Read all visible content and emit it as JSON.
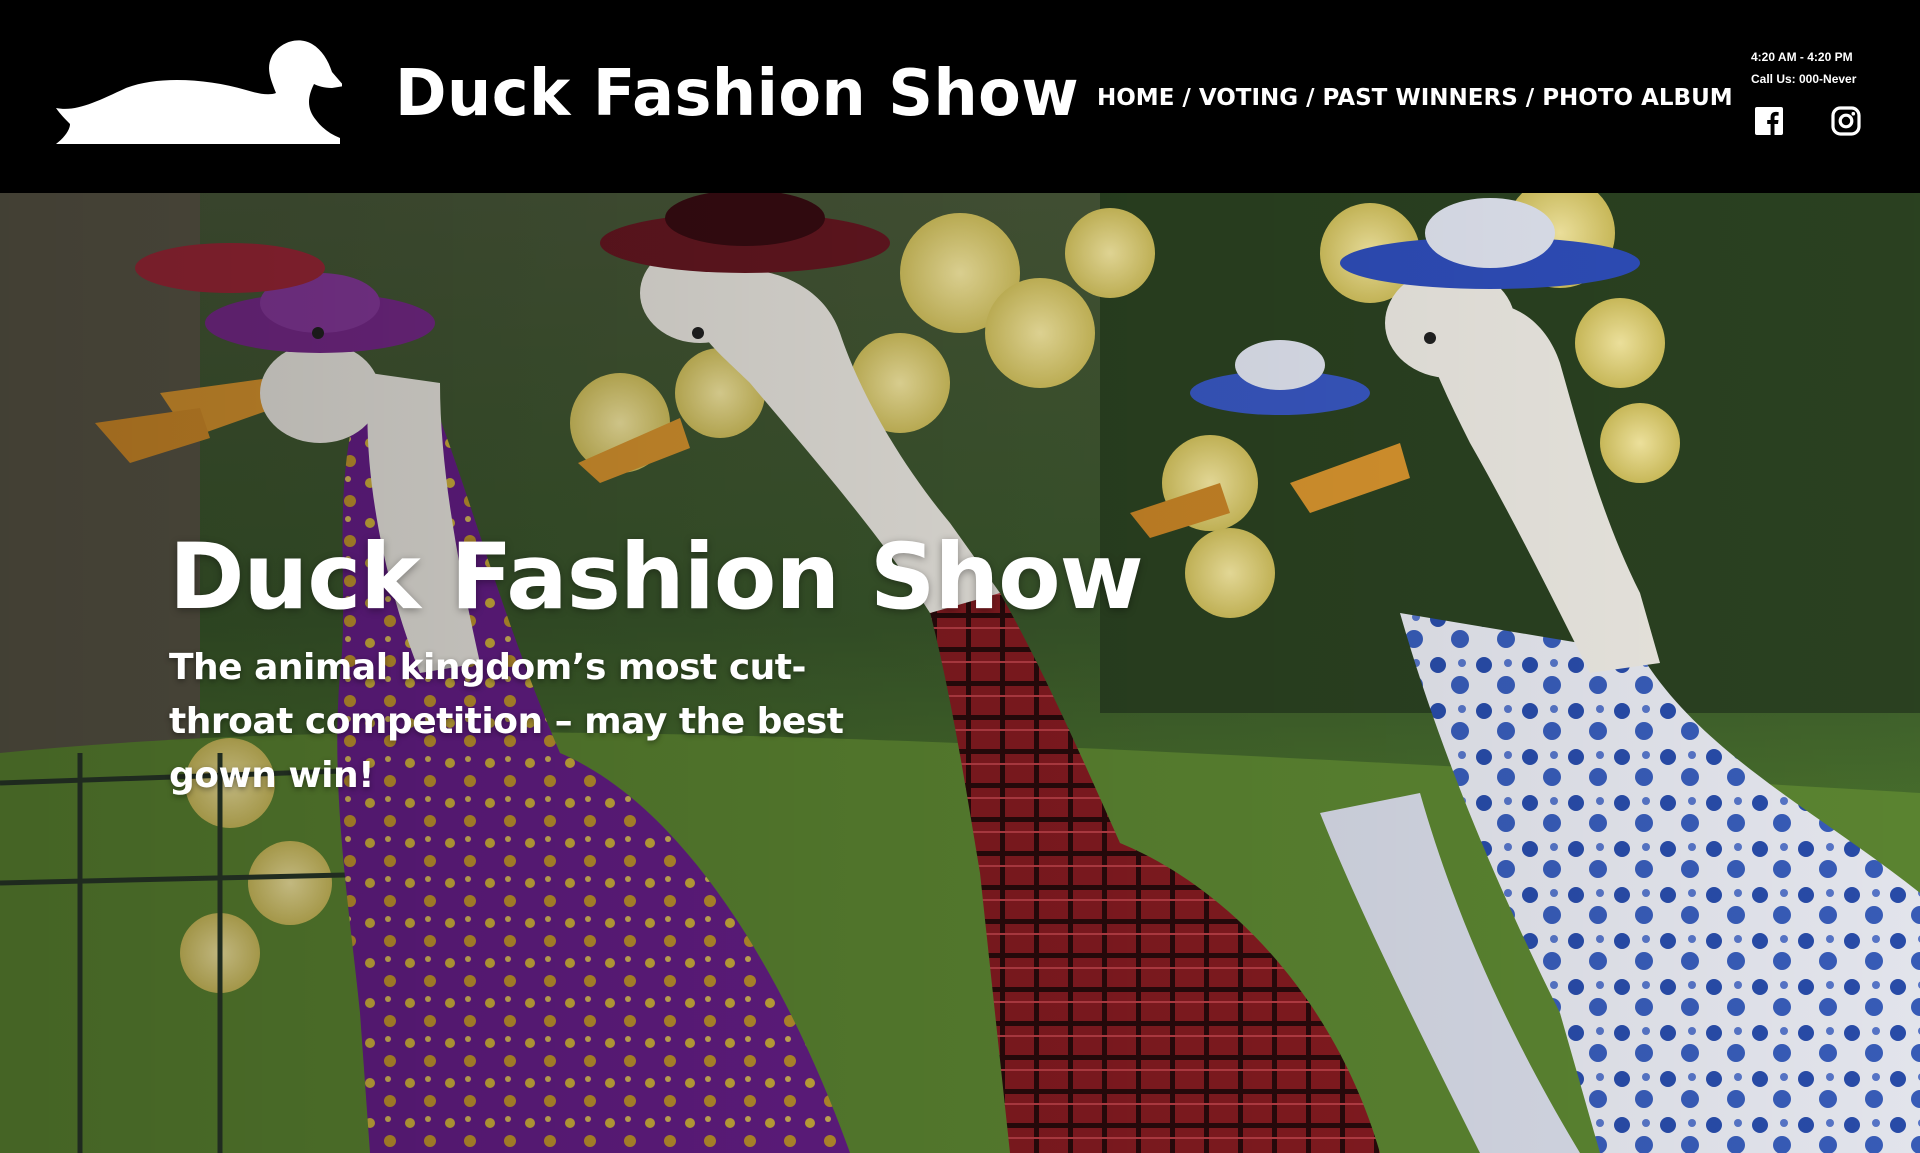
{
  "header": {
    "brand_title": "Duck Fashion Show",
    "logo_icon": "duck-silhouette-icon",
    "nav": {
      "home": "HOME",
      "voting": "VOTING",
      "past_winners": "PAST WINNERS",
      "photo_album": "PHOTO ALBUM",
      "separator": "/"
    },
    "hours": "4:20 AM - 4:20 PM",
    "phone": "Call Us: 000-Never",
    "social": {
      "facebook_icon": "facebook-icon",
      "instagram_icon": "instagram-icon"
    }
  },
  "hero": {
    "title": "Duck Fashion Show",
    "subtitle": "The animal kingdom’s most cut-throat competition – may the best gown win!",
    "background": "ducks-in-dresses-photo"
  },
  "colors": {
    "header_bg": "#000000",
    "text": "#ffffff"
  }
}
